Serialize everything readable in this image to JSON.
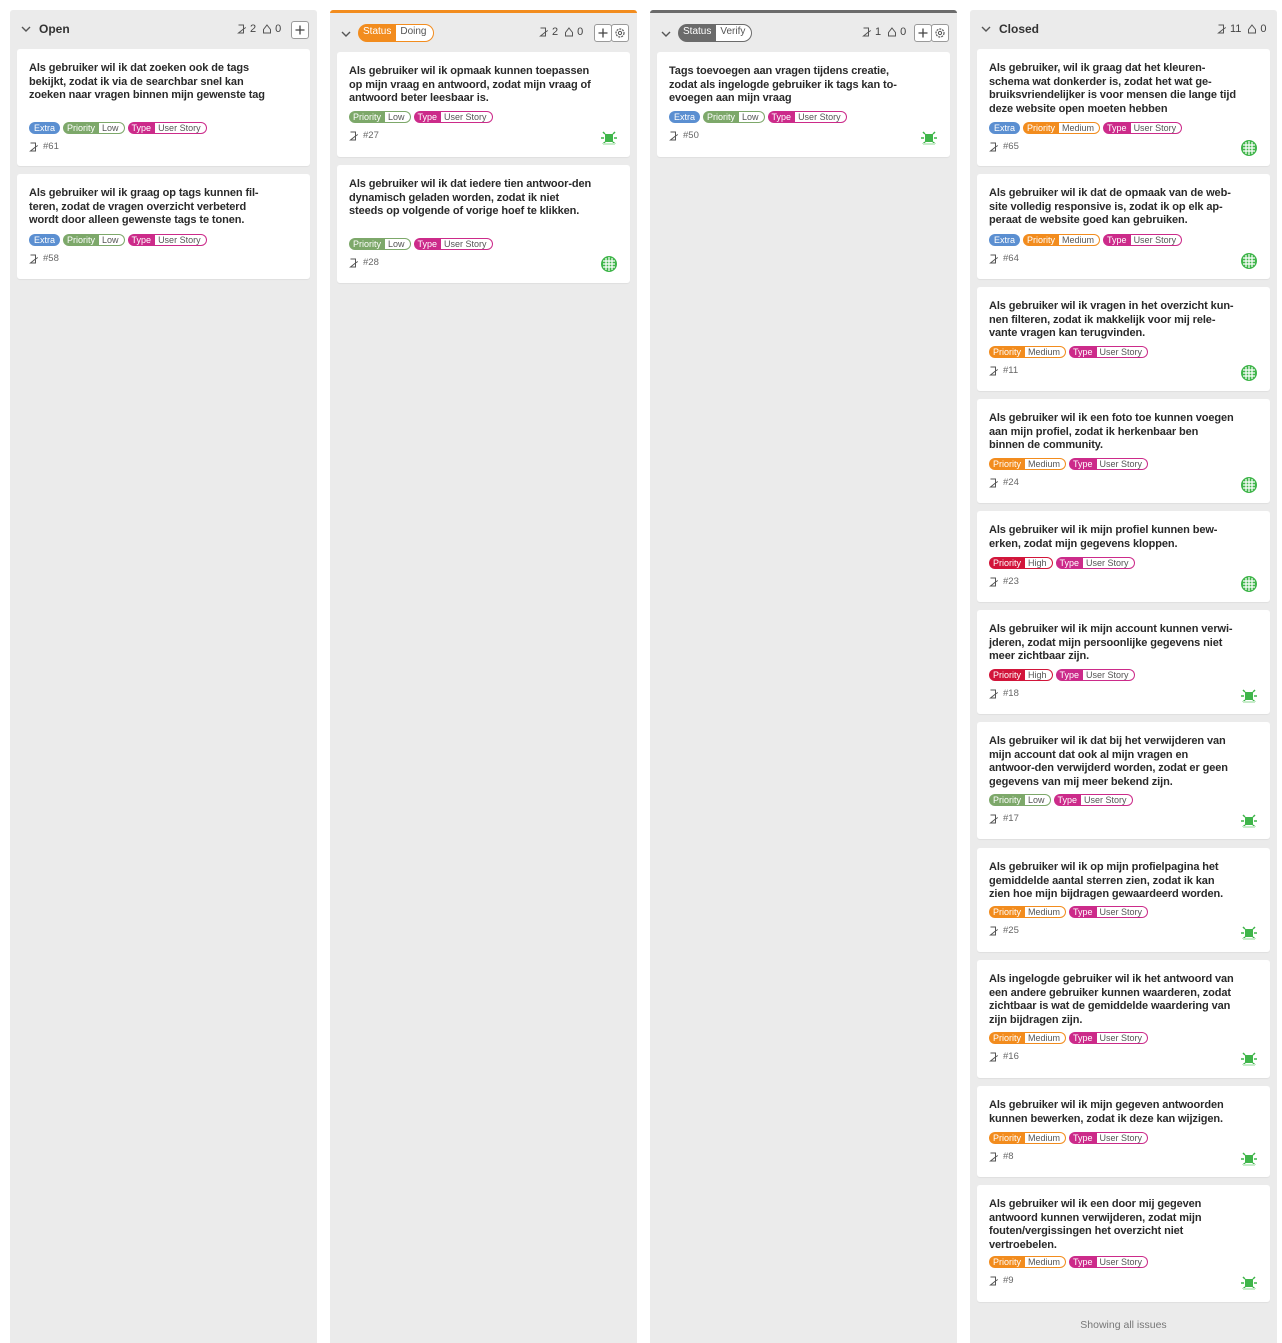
{
  "columns": {
    "open": {
      "title": "Open",
      "issues": "2",
      "prs": "0"
    },
    "doing": {
      "status_key": "Status",
      "status_value": "Doing",
      "issues": "2",
      "prs": "0"
    },
    "verify": {
      "status_key": "Status",
      "status_value": "Verify",
      "issues": "1",
      "prs": "0"
    },
    "closed": {
      "title": "Closed",
      "issues": "11",
      "prs": "0",
      "footer": "Showing all issues"
    }
  },
  "cards": {
    "c61": {
      "title": "Als gebruiker wil ik dat zoeken ook de tags bekijkt, zodat ik via de searchbar snel kan zoeken naar vragen binnen mijn gewenste tag",
      "number": "#61",
      "extra": "Extra",
      "priority_key": "Priority",
      "priority": "Low",
      "type_key": "Type",
      "type": "User Story"
    },
    "c58": {
      "title": "Als gebruiker wil ik graag op tags kunnen fil-teren, zodat de vragen overzicht verbeterd wordt door alleen gewenste tags te tonen.",
      "number": "#58",
      "extra": "Extra",
      "priority_key": "Priority",
      "priority": "Low",
      "type_key": "Type",
      "type": "User Story"
    },
    "c27": {
      "title": "Als gebruiker wil ik opmaak kunnen toepassen op mijn vraag en antwoord, zodat mijn vraag of antwoord beter leesbaar is.",
      "number": "#27",
      "priority_key": "Priority",
      "priority": "Low",
      "type_key": "Type",
      "type": "User Story"
    },
    "c28": {
      "title": "Als gebruiker wil ik dat iedere tien antwoor-den dynamisch geladen worden, zodat ik niet steeds op volgende of vorige hoef te klikken.",
      "number": "#28",
      "priority_key": "Priority",
      "priority": "Low",
      "type_key": "Type",
      "type": "User Story"
    },
    "c50": {
      "title": "Tags toevoegen aan vragen tijdens creatie, zodat als ingelogde gebruiker ik tags kan to-evoegen aan mijn vraag",
      "number": "#50",
      "extra": "Extra",
      "priority_key": "Priority",
      "priority": "Low",
      "type_key": "Type",
      "type": "User Story"
    },
    "c65": {
      "title": "Als gebruiker, wil ik graag dat het kleuren-schema wat donkerder is, zodat het wat ge-bruiksvriendelijker is voor mensen die lange tijd deze website open moeten hebben",
      "number": "#65",
      "extra": "Extra",
      "priority_key": "Priority",
      "priority": "Medium",
      "type_key": "Type",
      "type": "User Story"
    },
    "c64": {
      "title": "Als gebruiker wil ik dat de opmaak van de web-site volledig responsive is, zodat ik op elk ap-peraat de website goed kan gebruiken.",
      "number": "#64",
      "extra": "Extra",
      "priority_key": "Priority",
      "priority": "Medium",
      "type_key": "Type",
      "type": "User Story"
    },
    "c11": {
      "title": "Als gebruiker wil ik vragen in het overzicht kun-nen filteren, zodat ik makkelijk voor mij rele-vante vragen kan terugvinden.",
      "number": "#11",
      "priority_key": "Priority",
      "priority": "Medium",
      "type_key": "Type",
      "type": "User Story"
    },
    "c24": {
      "title": "Als gebruiker wil ik een foto toe kunnen voegen aan mijn profiel, zodat ik herkenbaar ben binnen de community.",
      "number": "#24",
      "priority_key": "Priority",
      "priority": "Medium",
      "type_key": "Type",
      "type": "User Story"
    },
    "c23": {
      "title": "Als gebruiker wil ik mijn profiel kunnen bew-erken, zodat mijn gegevens kloppen.",
      "number": "#23",
      "priority_key": "Priority",
      "priority": "High",
      "type_key": "Type",
      "type": "User Story"
    },
    "c18": {
      "title": "Als gebruiker wil ik mijn account kunnen verwi-jderen, zodat mijn persoonlijke gegevens niet meer zichtbaar zijn.",
      "number": "#18",
      "priority_key": "Priority",
      "priority": "High",
      "type_key": "Type",
      "type": "User Story"
    },
    "c17": {
      "title": "Als gebruiker wil ik dat bij het verwijderen van mijn account dat ook al mijn vragen en antwoor-den verwijderd worden, zodat er geen gegevens van mij meer bekend zijn.",
      "number": "#17",
      "priority_key": "Priority",
      "priority": "Low",
      "type_key": "Type",
      "type": "User Story"
    },
    "c25": {
      "title": "Als gebruiker wil ik op mijn profielpagina het gemiddelde aantal sterren zien, zodat ik kan zien hoe mijn bijdragen gewaardeerd worden.",
      "number": "#25",
      "priority_key": "Priority",
      "priority": "Medium",
      "type_key": "Type",
      "type": "User Story"
    },
    "c16": {
      "title": "Als ingelogde gebruiker wil ik het antwoord van een andere gebruiker kunnen waarderen, zodat zichtbaar is wat de gemiddelde waardering van zijn bijdragen zijn.",
      "number": "#16",
      "priority_key": "Priority",
      "priority": "Medium",
      "type_key": "Type",
      "type": "User Story"
    },
    "c8": {
      "title": "Als gebruiker wil ik mijn gegeven antwoorden kunnen bewerken, zodat ik deze kan wijzigen.",
      "number": "#8",
      "priority_key": "Priority",
      "priority": "Medium",
      "type_key": "Type",
      "type": "User Story"
    },
    "c9": {
      "title": "Als gebruiker wil ik een door mij gegeven antwoord kunnen verwijderen, zodat mijn fouten/vergissingen het overzicht niet vertroebelen.",
      "number": "#9",
      "priority_key": "Priority",
      "priority": "Medium",
      "type_key": "Type",
      "type": "User Story"
    }
  },
  "colors": {
    "doing": "#f28c1e",
    "verify": "#6b6b6b",
    "extra": "#5b8fd1",
    "low": "#7da86a",
    "medium": "#f28c1e",
    "high": "#d2153a",
    "type": "#cc2b8a",
    "avatar": "#3fb54a"
  },
  "icons": {
    "collapse": "chevron-down-icon",
    "issue": "issue-icon",
    "pr": "pull-request-icon",
    "add": "plus-icon",
    "settings": "gear-icon",
    "avatar": "identicon-avatar-icon"
  }
}
